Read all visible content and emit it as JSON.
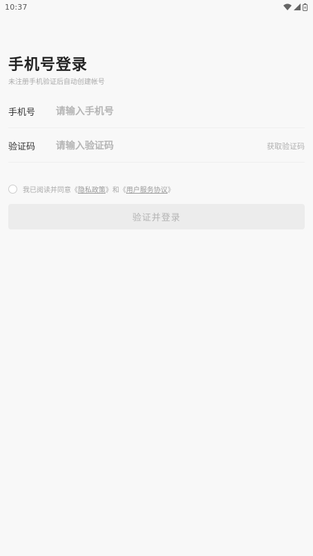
{
  "status_bar": {
    "time": "10:37"
  },
  "header": {
    "title": "手机号登录",
    "subtitle": "未注册手机验证后自动创建帐号"
  },
  "form": {
    "phone": {
      "label": "手机号",
      "placeholder": "请输入手机号",
      "value": ""
    },
    "code": {
      "label": "验证码",
      "placeholder": "请输入验证码",
      "value": "",
      "get_code_label": "获取验证码"
    }
  },
  "agreement": {
    "checked": false,
    "prefix": "我已阅读并同意",
    "open_quote": "《",
    "close_quote": "》",
    "privacy_label": "隐私政策",
    "joiner": "和",
    "service_label": "用户服务协议"
  },
  "submit": {
    "label": "验证并登录"
  },
  "colors": {
    "background": "#f8f8f8",
    "button_bg": "#ececec",
    "button_text": "#b3b3b3",
    "hint_text": "#aaaaaa"
  }
}
